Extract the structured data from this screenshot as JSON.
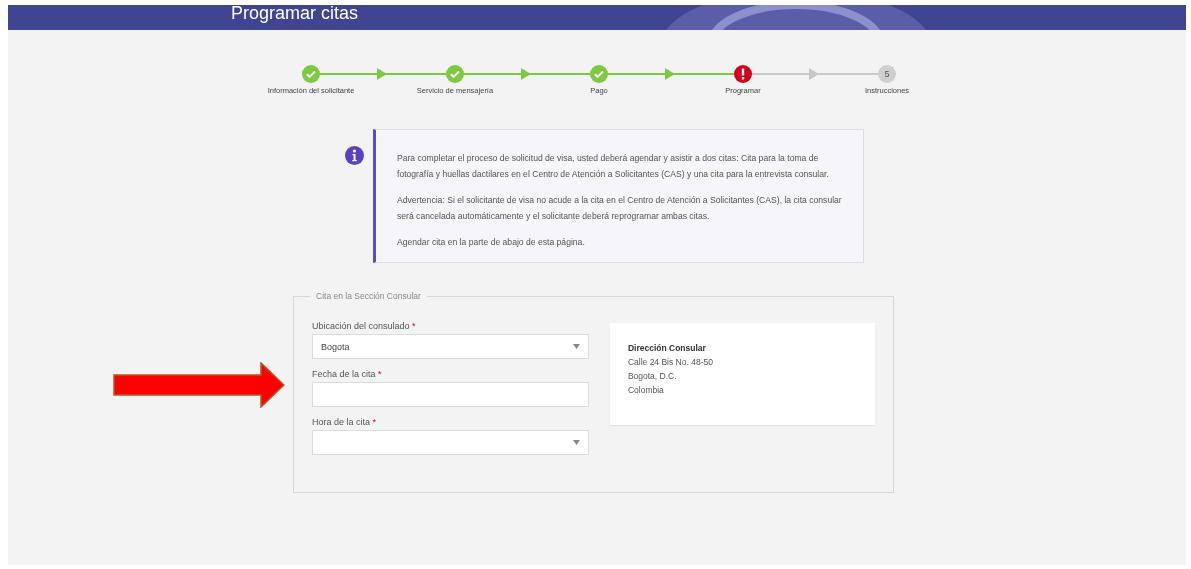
{
  "header": {
    "title": "Programar citas"
  },
  "steps": [
    {
      "label": "Información del solicitante",
      "kind": "done"
    },
    {
      "label": "Servicio de mensajería",
      "kind": "done"
    },
    {
      "label": "Pago",
      "kind": "done"
    },
    {
      "label": "Programar",
      "kind": "error"
    },
    {
      "label": "Instrucciones",
      "kind": "pending",
      "number": "5"
    }
  ],
  "info": {
    "paragraphs": [
      "Para completar el proceso de solicitud de visa, usted deberá agendar y asistir a dos citas: Cita para la toma de fotografía y huellas dactilares en el Centro de Atención a Solicitantes (CAS) y una cita para la entrevista consular.",
      "Advertencia: Si el solicitante de visa no acude a la cita en el Centro de Atención a Solicitantes (CAS), la cita consular será cancelada automáticamente y el solicitante deberá reprogramar ambas citas.",
      "Agendar cita en la parte de abajo de esta página."
    ]
  },
  "section": {
    "legend": "Cita en la Sección Consular",
    "fields": [
      {
        "kind": "select",
        "label": "Ubicación del consulado",
        "required_mark": "*",
        "value": "Bogota"
      },
      {
        "kind": "text",
        "label": "Fecha de la cita",
        "required_mark": "*"
      },
      {
        "kind": "select",
        "label": "Hora de la cita",
        "required_mark": "*"
      }
    ],
    "address": {
      "title": "Dirección Consular",
      "lines": [
        "Calle 24 Bis No. 48-50",
        "Bogota, D.C.",
        "Colombia"
      ]
    }
  }
}
